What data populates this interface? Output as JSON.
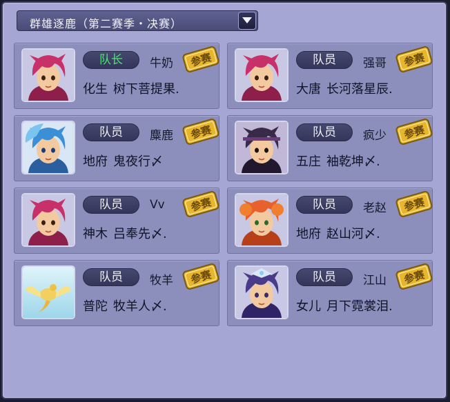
{
  "header": {
    "title": "群雄逐鹿（第二赛季・决赛）"
  },
  "stamp_label": "参赛",
  "colors": {
    "leader_role": "#52e07c",
    "stamp": "#e8b62c"
  },
  "players": [
    {
      "role": "队长",
      "nickname": "牛奶",
      "school": "化生",
      "name": "树下菩提果.",
      "avatar": "red-hair-boy"
    },
    {
      "role": "队员",
      "nickname": "强哥",
      "school": "大唐",
      "name": "长河落星辰.",
      "avatar": "red-hair-boy"
    },
    {
      "role": "队员",
      "nickname": "麋鹿",
      "school": "地府",
      "name": "鬼夜行〆",
      "avatar": "blue-hair-boy"
    },
    {
      "role": "队员",
      "nickname": "疯少",
      "school": "五庄",
      "name": "袖乾坤〆.",
      "avatar": "dark-hair-boy"
    },
    {
      "role": "队员",
      "nickname": "Vv",
      "school": "神木",
      "name": "吕奉先〆.",
      "avatar": "red-hair-boy"
    },
    {
      "role": "队员",
      "nickname": "老赵",
      "school": "地府",
      "name": "赵山河〆.",
      "avatar": "orange-hair-girl"
    },
    {
      "role": "队员",
      "nickname": "牧羊",
      "school": "普陀",
      "name": "牧羊人〆.",
      "avatar": "golden-phoenix"
    },
    {
      "role": "队员",
      "nickname": "江山",
      "school": "女儿",
      "name": "月下霓裳泪.",
      "avatar": "purple-hair-girl"
    }
  ]
}
